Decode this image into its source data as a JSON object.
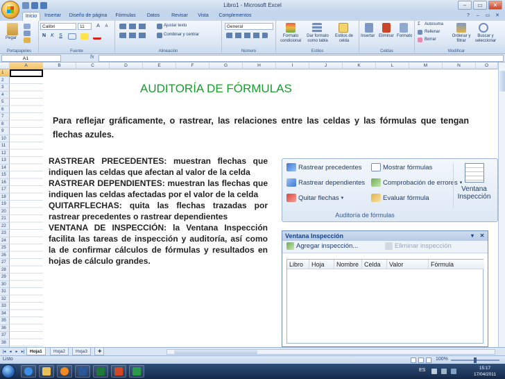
{
  "window": {
    "title": "Libro1 - Microsoft Excel",
    "controls": {
      "minimize": "–",
      "maximize": "▭",
      "close": "✕"
    }
  },
  "menu_tabs": [
    {
      "label": "Inicio",
      "active": true
    },
    {
      "label": "Insertar"
    },
    {
      "label": "Diseño de página"
    },
    {
      "label": "Fórmulas"
    },
    {
      "label": "Datos"
    },
    {
      "label": "Revisar"
    },
    {
      "label": "Vista"
    },
    {
      "label": "Complementos"
    }
  ],
  "ribbon": {
    "clipboard": {
      "label": "Portapapeles",
      "paste": "Pegar"
    },
    "font": {
      "label": "Fuente",
      "name": "Calibri",
      "size": "11",
      "bold": "N",
      "italic": "K",
      "underline": "S"
    },
    "alignment": {
      "label": "Alineación",
      "wrap": "Ajustar texto",
      "merge": "Combinar y centrar"
    },
    "number": {
      "label": "Número",
      "format": "General"
    },
    "styles": {
      "label": "Estilos",
      "conditional": "Formato condicional",
      "as_table": "Dar formato como tabla",
      "cell_styles": "Estilos de celda"
    },
    "cells": {
      "label": "Celdas",
      "insert": "Insertar",
      "delete": "Eliminar",
      "format": "Formato"
    },
    "editing": {
      "label": "Modificar",
      "autosum": "Autosuma",
      "fill": "Rellenar",
      "clear": "Borrar",
      "sort": "Ordenar y filtrar",
      "find": "Buscar y seleccionar"
    }
  },
  "formula_bar": {
    "name_box": "A1",
    "fx": "fx",
    "value": ""
  },
  "columns": [
    "A",
    "B",
    "C",
    "D",
    "E",
    "F",
    "G",
    "H",
    "I",
    "J",
    "K",
    "L",
    "M",
    "N",
    "O"
  ],
  "rows": [
    "1",
    "2",
    "3",
    "4",
    "5",
    "6",
    "7",
    "8",
    "9",
    "10",
    "11",
    "12",
    "13",
    "14",
    "15",
    "16",
    "17",
    "18",
    "19",
    "20",
    "21",
    "22",
    "23",
    "24",
    "25",
    "26",
    "27",
    "28",
    "29",
    "30",
    "31",
    "32",
    "33",
    "34",
    "35",
    "36",
    "37",
    "38"
  ],
  "content": {
    "title": "AUDITORÍA DE FÓRMULAS",
    "intro": "Para reflejar gráficamente, o rastrear, las relaciones entre las celdas y las fórmulas que tengan flechas azules.",
    "paragraphs": [
      "RASTREAR PRECEDENTES: muestran flechas que indiquen las celdas que afectan al valor de la celda",
      "RASTREAR DEPENDIENTES: muestran las flechas que indiquen las celdas afectadas por el valor de la celda",
      "QUITARFLECHAS: quita las flechas trazadas por rastrear precedentes o rastrear dependientes",
      "VENTANA DE INSPECCIÓN: la Ventana Inspección facilita las tareas de inspección y auditoría, así como la de confirmar cálculos de fórmulas y resultados en hojas de cálculo grandes."
    ]
  },
  "audit_panel": {
    "trace_precedents": "Rastrear precedentes",
    "trace_dependents": "Rastrear dependientes",
    "remove_arrows": "Quitar flechas",
    "show_formulas": "Mostrar fórmulas",
    "error_checking": "Comprobación de errores",
    "evaluate_formula": "Evaluar fórmula",
    "watch_window": "Ventana Inspección",
    "group_label": "Auditoría de fórmulas"
  },
  "watch_window": {
    "title": "Ventana Inspección",
    "add": "Agregar inspección...",
    "delete": "Eliminar inspección",
    "columns": [
      "Libro",
      "Hoja",
      "Nombre",
      "Celda",
      "Valor",
      "Fórmula"
    ]
  },
  "sheets": [
    {
      "label": "Hoja1",
      "active": true
    },
    {
      "label": "Hoja2"
    },
    {
      "label": "Hoja3"
    }
  ],
  "status": {
    "text": "Listo",
    "zoom": "100%"
  },
  "taskbar": {
    "language": "ES",
    "time": "15:17",
    "date": "17/04/2011"
  },
  "colors": {
    "title_green": "#1a9c2e",
    "ribbon_blue": "#dbe6f4",
    "taskbar": "#1d365e"
  }
}
